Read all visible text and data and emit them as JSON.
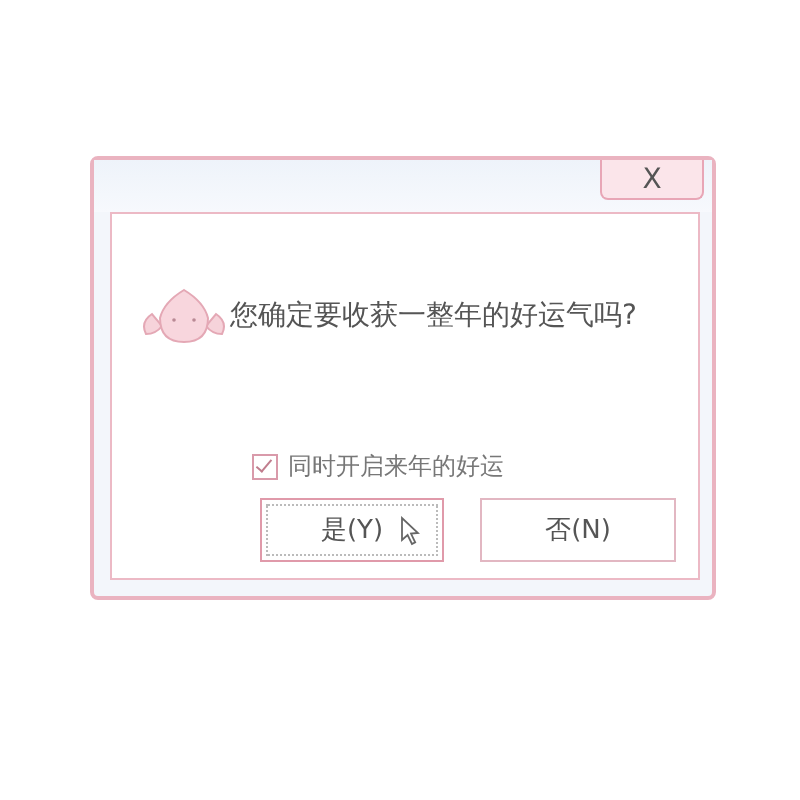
{
  "window": {
    "close_label": "X"
  },
  "message": "您确定要收获一整年的好运气吗?",
  "checkbox": {
    "label": "同时开启来年的好运",
    "checked": true
  },
  "buttons": [
    {
      "label": "是(Y)",
      "focused": true
    },
    {
      "label": "否(N)",
      "focused": false
    }
  ]
}
